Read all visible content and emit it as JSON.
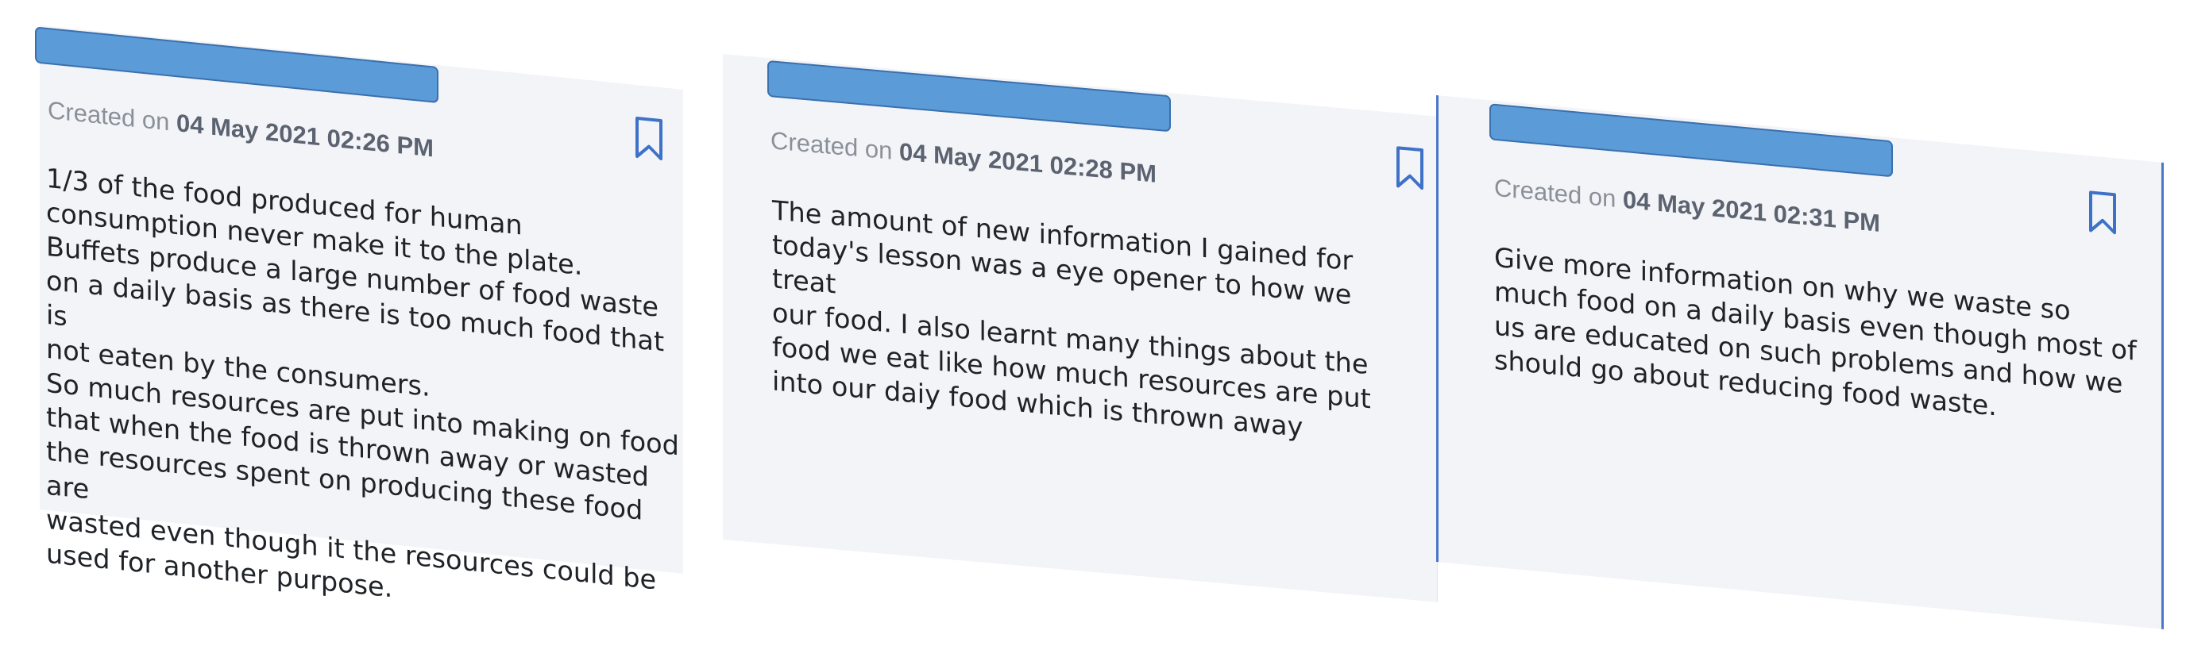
{
  "colors": {
    "card_background": "#f3f4f8",
    "title_redaction": "#5b9bd8",
    "bookmark_icon": "#3e72c8",
    "selected_border": "#4a77c9",
    "created_label": "#8a9099",
    "created_date": "#5c6370",
    "body_text": "#1f2328"
  },
  "notes": [
    {
      "title": "",
      "created_prefix": "Created on",
      "created_date": "04 May 2021 02:26 PM",
      "bookmark_icon": "bookmark-outline-icon",
      "body": "1/3 of the food produced for human\nconsumption never make it to the plate.\nBuffets produce a large number of food waste\non a daily basis as there is too much food that is\nnot eaten by the consumers.\nSo much resources are put into making on food\nthat when the food is thrown away or wasted\nthe resources spent on producing these food are\nwasted even though it the resources could be\nused for another purpose."
    },
    {
      "title": "",
      "created_prefix": "Created on",
      "created_date": "04 May 2021 02:28 PM",
      "bookmark_icon": "bookmark-outline-icon",
      "body": "The amount of new information I gained for\ntoday's lesson was a eye opener to how we treat\nour food. I also learnt many things about the\nfood we eat like how much resources are put\ninto our daiy food which is thrown away"
    },
    {
      "title": "",
      "created_prefix": "Created on",
      "created_date": "04 May 2021 02:31 PM",
      "bookmark_icon": "bookmark-outline-icon",
      "body": "Give more information on why we waste so\nmuch food on a daily basis even though most of\nus are educated on such problems and how we\nshould go about reducing food waste."
    }
  ]
}
